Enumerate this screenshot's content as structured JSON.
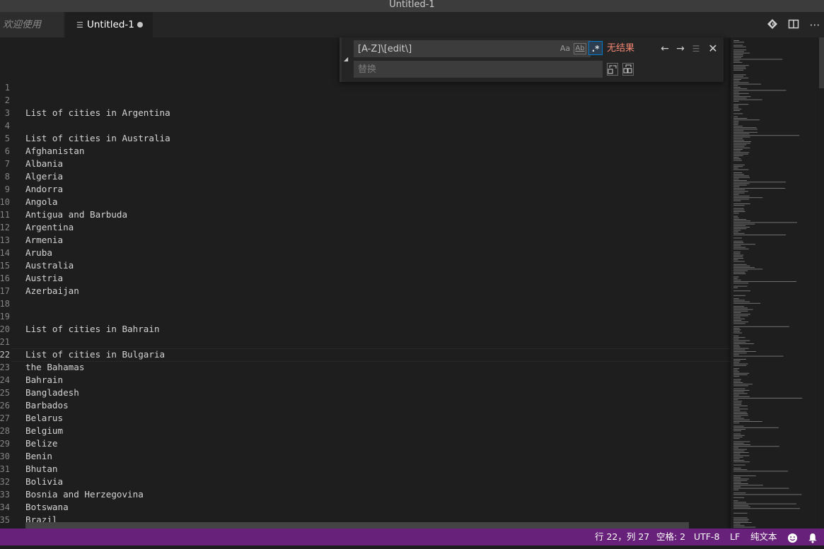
{
  "window": {
    "title": "Untitled-1"
  },
  "tabs": [
    {
      "label": "欢迎使用",
      "active": false
    },
    {
      "label": "Untitled-1",
      "active": true,
      "dirty": true
    }
  ],
  "tab_actions": [
    "open-changes-icon",
    "split-editor-icon",
    "more-actions-icon"
  ],
  "find_widget": {
    "query": "[A-Z]\\[edit\\]",
    "replace_placeholder": "替换",
    "match_case_label": "Aa",
    "whole_word_label": "Ab",
    "regex_label": ".*",
    "regex_enabled": true,
    "result_text": "无结果",
    "result_color": "#f48771"
  },
  "editor": {
    "current_line": 22,
    "lines": [
      "",
      "",
      "List of cities in Argentina",
      "",
      "List of cities in Australia",
      "Afghanistan",
      "Albania",
      "Algeria",
      "Andorra",
      "Angola",
      "Antigua and Barbuda",
      "Argentina",
      "Armenia",
      "Aruba",
      "Australia",
      "Austria",
      "Azerbaijan",
      "",
      "",
      "List of cities in Bahrain",
      "",
      "List of cities in Bulgaria",
      "the Bahamas",
      "Bahrain",
      "Bangladesh",
      "Barbados",
      "Belarus",
      "Belgium",
      "Belize",
      "Benin",
      "Bhutan",
      "Bolivia",
      "Bosnia and Herzegovina",
      "Botswana",
      "Brazil"
    ]
  },
  "statusbar": {
    "position": "行 22，列 27",
    "indent": "空格: 2",
    "encoding": "UTF-8",
    "eol": "LF",
    "language": "纯文本",
    "background": "#68217a"
  }
}
